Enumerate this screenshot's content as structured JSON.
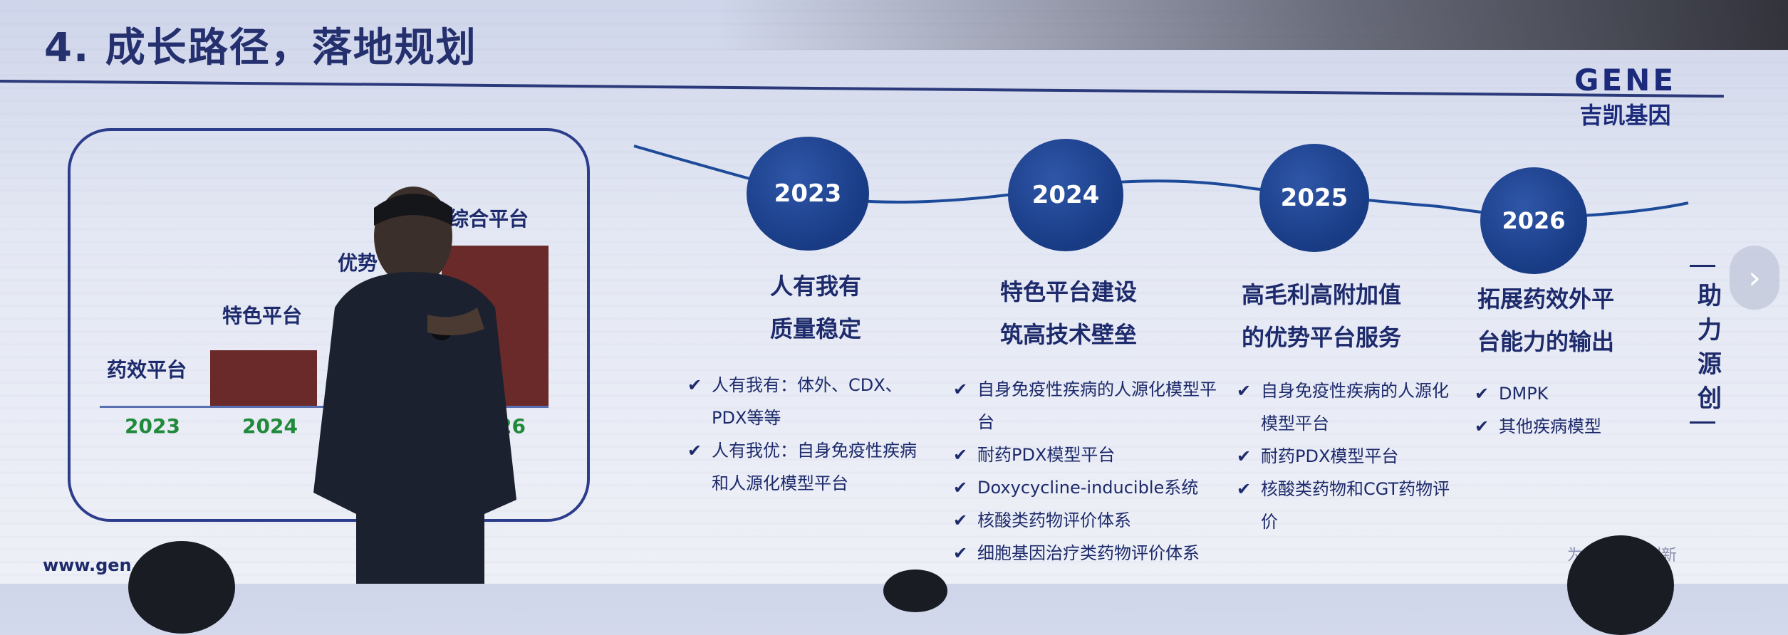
{
  "slide": {
    "title": "4. 成长路径，落地规划",
    "logo": {
      "en": "GENE",
      "cn": "吉凯基因"
    },
    "url": "www.gen…m.cn",
    "footer": "为………西创新"
  },
  "left_panel": {
    "bars": [
      {
        "label": "药效平台",
        "year": "2023"
      },
      {
        "label": "特色平台",
        "year": "2024"
      },
      {
        "label": "优势",
        "year": ""
      },
      {
        "label": "综合平台",
        "year": "2026"
      }
    ]
  },
  "timeline": [
    {
      "year": "2023",
      "heading1": "人有我有",
      "heading2": "质量稳定",
      "bullets": [
        "人有我有：体外、CDX、PDX等等",
        "人有我优：自身免疫性疾病和人源化模型平台"
      ]
    },
    {
      "year": "2024",
      "heading1": "特色平台建设",
      "heading2": "筑高技术壁垒",
      "bullets": [
        "自身免疫性疾病的人源化模型平台",
        "耐药PDX模型平台",
        "Doxycycline-inducible系统",
        "核酸类药物评价体系",
        "细胞基因治疗类药物评价体系"
      ]
    },
    {
      "year": "2025",
      "heading1": "高毛利高附加值",
      "heading2": "的优势平台服务",
      "bullets": [
        "自身免疫性疾病的人源化模型平台",
        "耐药PDX模型平台",
        "核酸类药物和CGT药物评价"
      ]
    },
    {
      "year": "2026",
      "heading1": "拓展药效外平",
      "heading2": "台能力的输出",
      "bullets": [
        "DMPK",
        "其他疾病模型"
      ]
    }
  ],
  "vertical_text": [
    "助",
    "力",
    "源",
    "创"
  ],
  "colors": {
    "accent": "#1b3f8a",
    "bar": "#6a2a2a",
    "year_green": "#1f8a3a"
  },
  "icons": {
    "check": "checkmark-icon",
    "next": "chevron-right-icon"
  }
}
